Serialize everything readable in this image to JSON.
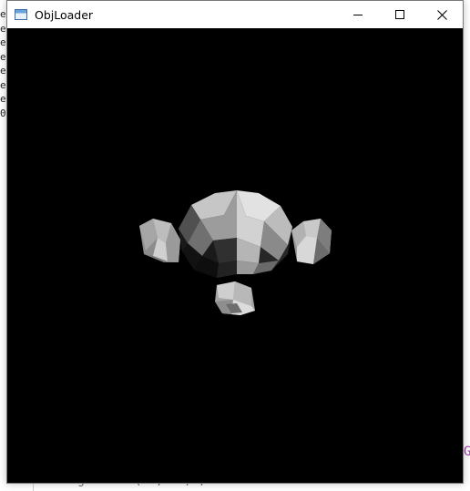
{
  "window": {
    "title": "ObjLoader",
    "icon": "app-window-icon",
    "controls": {
      "minimize_icon": "minimize-icon",
      "maximize_icon": "maximize-icon",
      "close_icon": "close-icon"
    }
  },
  "viewport": {
    "background": "#000000",
    "model": "shaded-monkey-head-mesh"
  },
  "background_editor": {
    "left_glyphs": [
      "e",
      "e",
      "e",
      "e",
      "e",
      "e",
      "e",
      "0"
    ],
    "bottom_code": "gl…………… (……, ……) ;",
    "right_fragment": "G"
  }
}
